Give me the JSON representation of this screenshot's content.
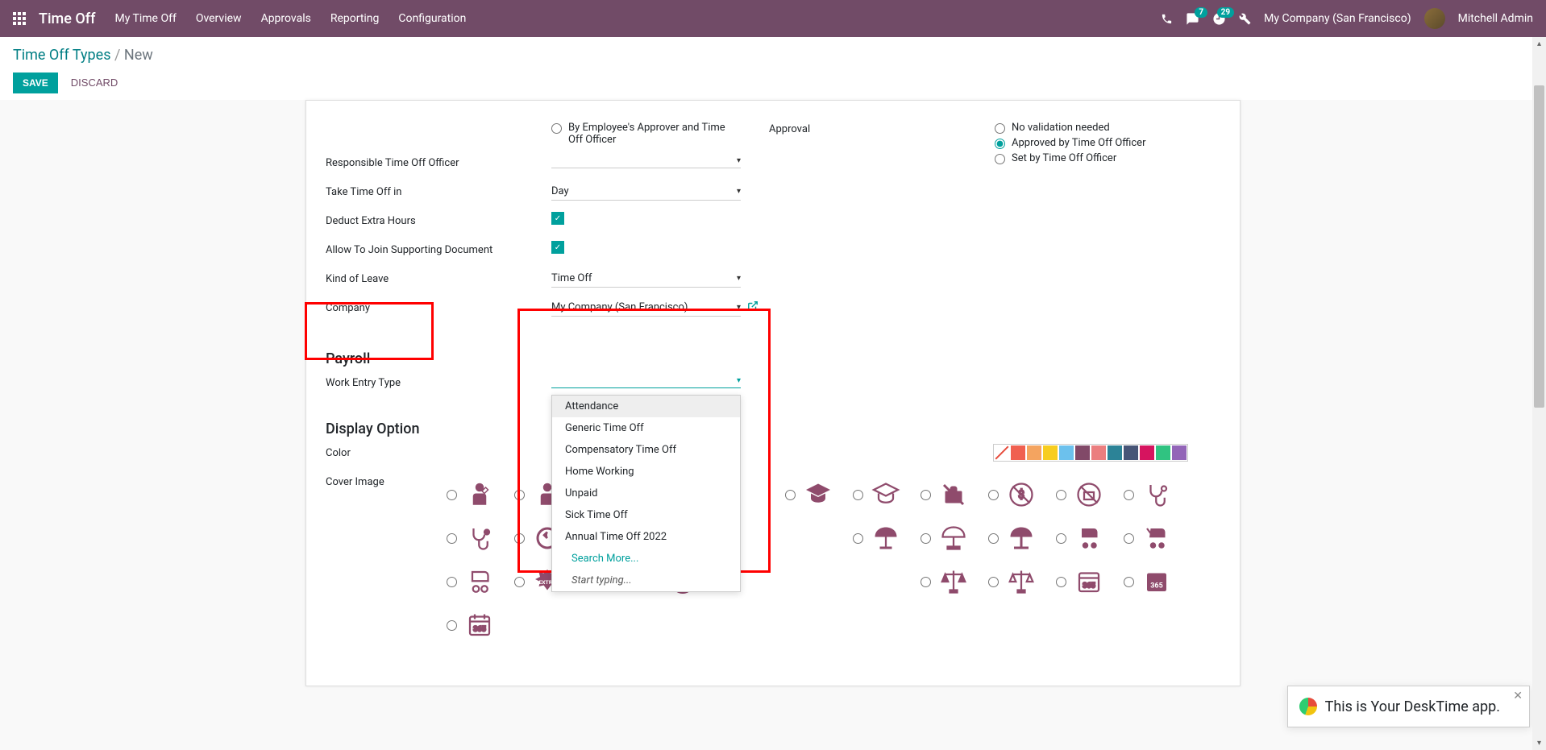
{
  "topnav": {
    "brand": "Time Off",
    "items": [
      "My Time Off",
      "Overview",
      "Approvals",
      "Reporting",
      "Configuration"
    ],
    "messages_badge": "7",
    "activities_badge": "29",
    "company": "My Company (San Francisco)",
    "user": "Mitchell Admin"
  },
  "breadcrumb": {
    "parent": "Time Off Types",
    "current": "New"
  },
  "buttons": {
    "save": "SAVE",
    "discard": "DISCARD"
  },
  "form": {
    "radio_by_employee": "By Employee's Approver and Time Off Officer",
    "responsible_label": "Responsible Time Off Officer",
    "take_in_label": "Take Time Off in",
    "take_in_value": "Day",
    "deduct_label": "Deduct Extra Hours",
    "allow_doc_label": "Allow To Join Supporting Document",
    "kind_label": "Kind of Leave",
    "kind_value": "Time Off",
    "company_label": "Company",
    "company_value": "My Company (San Francisco)",
    "approval_label": "Approval",
    "approval_opts": [
      "No validation needed",
      "Approved by Time Off Officer",
      "Set by Time Off Officer"
    ]
  },
  "payroll": {
    "header": "Payroll",
    "wet_label": "Work Entry Type",
    "dropdown": {
      "items": [
        "Attendance",
        "Generic Time Off",
        "Compensatory Time Off",
        "Home Working",
        "Unpaid",
        "Sick Time Off",
        "Annual Time Off 2022"
      ],
      "search_more": "Search More...",
      "start_typing": "Start typing..."
    }
  },
  "display": {
    "header": "Display Option",
    "color_label": "Color",
    "cover_label": "Cover Image",
    "colors": [
      "#FFFFFF",
      "#F06050",
      "#F4A460",
      "#F7CD1F",
      "#6CC1ED",
      "#814968",
      "#EB7E7F",
      "#2C8397",
      "#475577",
      "#D6145F",
      "#30C381",
      "#9365B8"
    ]
  },
  "toast": {
    "text": "This is Your DeskTime app."
  }
}
